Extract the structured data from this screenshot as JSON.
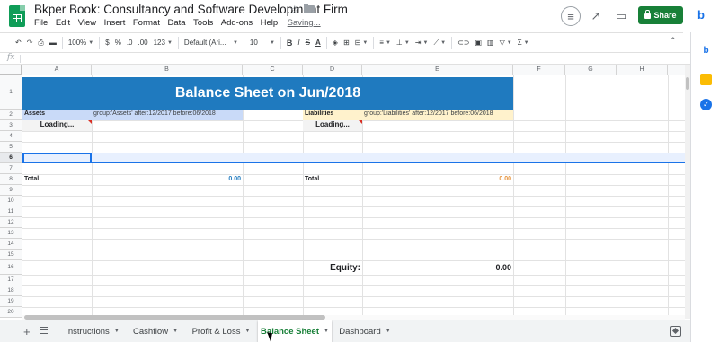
{
  "app": {
    "doc_title": "Bkper Book: Consultancy and Software Development Firm",
    "menu": [
      "File",
      "Edit",
      "View",
      "Insert",
      "Format",
      "Data",
      "Tools",
      "Add-ons",
      "Help"
    ],
    "save_status": "Saving...",
    "share_label": "Share"
  },
  "toolbar": {
    "zoom": "100%",
    "currency": "$",
    "percent": "%",
    "decrease_decimals": ".0",
    "increase_decimals": ".00",
    "more_formats": "123",
    "font": "Default (Ari...",
    "font_size": "10",
    "bold": "B",
    "italic": "I",
    "strike": "S",
    "text_color": "A"
  },
  "formula_bar": {
    "fx": "fx"
  },
  "columns": [
    "A",
    "B",
    "C",
    "D",
    "E",
    "F",
    "G",
    "H"
  ],
  "rows": [
    "1",
    "2",
    "3",
    "4",
    "5",
    "6",
    "7",
    "8",
    "9",
    "10",
    "11",
    "12",
    "13",
    "14",
    "15",
    "16",
    "17",
    "18",
    "19",
    "20"
  ],
  "sheet": {
    "title": "Balance Sheet on Jun/2018",
    "assets_label": "Assets",
    "assets_query": "group:'Assets' after:12/2017 before:06/2018",
    "liabilities_label": "Liabilities",
    "liabilities_query": "group:'Liabilities' after:12/2017 before:06/2018",
    "loading_a": "Loading...",
    "loading_d": "Loading...",
    "total_a_label": "Total",
    "total_a_value": "0.00",
    "total_d_label": "Total",
    "total_d_value": "0.00",
    "equity_label": "Equity:",
    "equity_value": "0.00"
  },
  "tabs": [
    {
      "label": "Instructions"
    },
    {
      "label": "Cashflow"
    },
    {
      "label": "Profit & Loss"
    },
    {
      "label": "Balance Sheet"
    },
    {
      "label": "Dashboard"
    }
  ],
  "active_tab": "Balance Sheet",
  "colors": {
    "brand_green": "#188038",
    "banner_blue": "#1f7abf",
    "assets_bg": "#c9daf8",
    "liabilities_bg": "#fff2cc",
    "total_orange": "#e69138",
    "selection_blue": "#1a73e8"
  }
}
